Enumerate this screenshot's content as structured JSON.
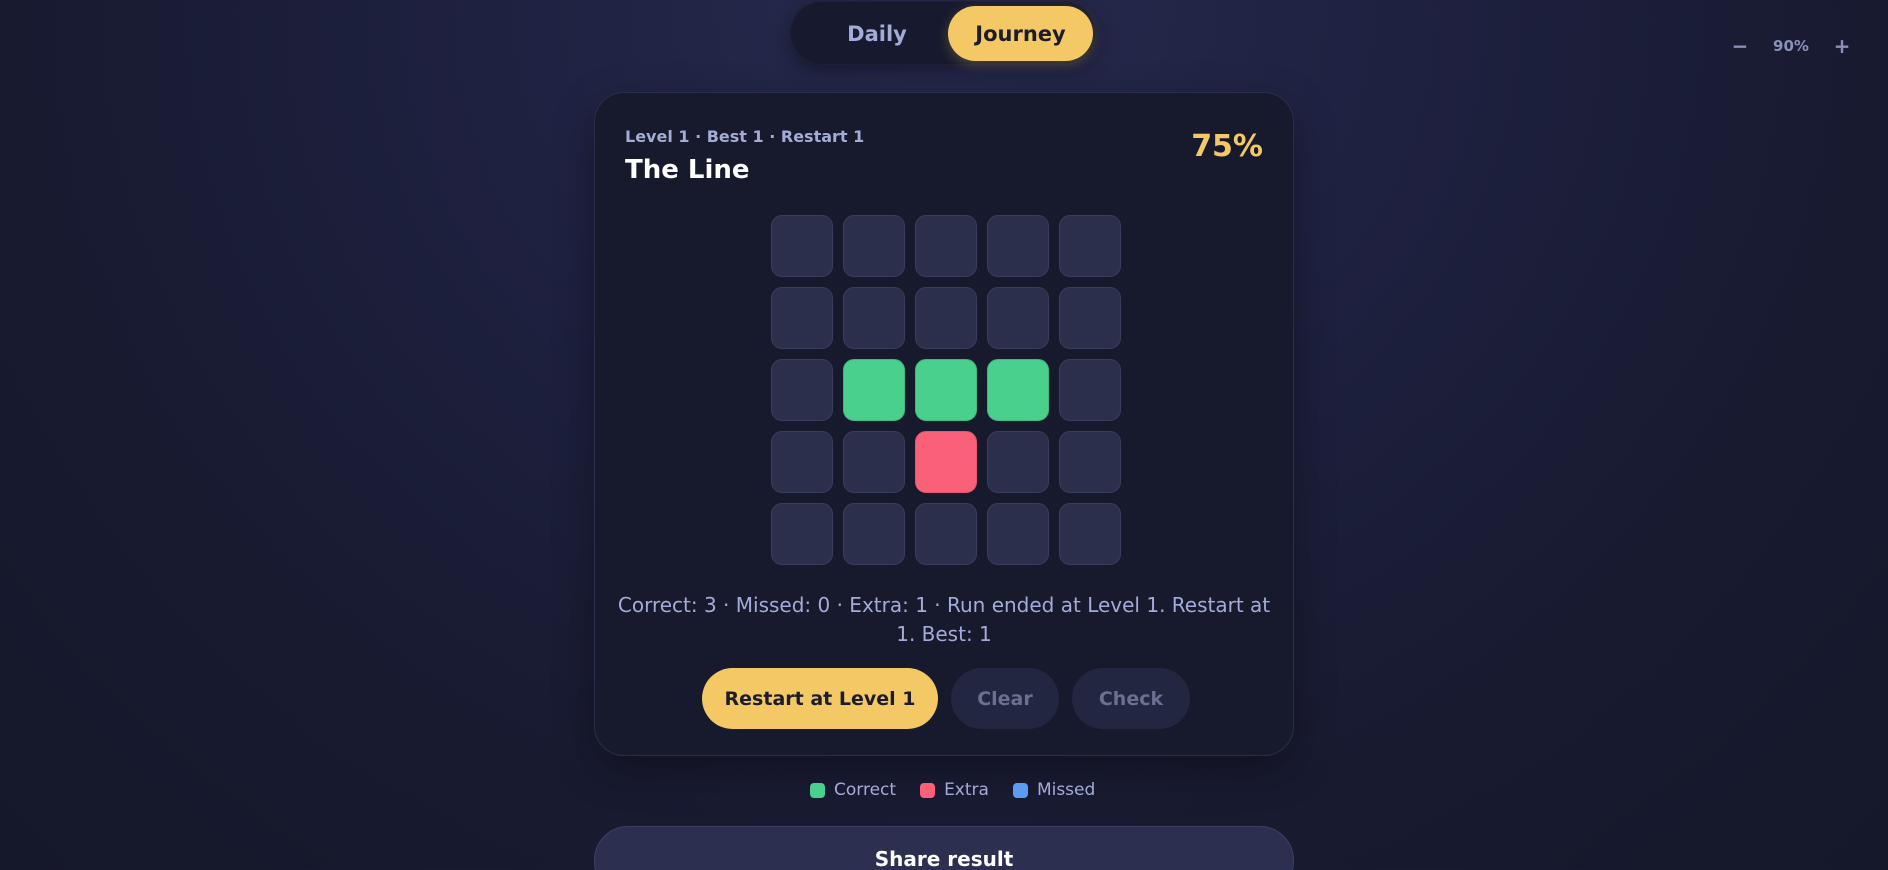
{
  "modes": {
    "daily_label": "Daily",
    "journey_label": "Journey",
    "active": "Journey"
  },
  "zoom": {
    "minus": "−",
    "value": "90%",
    "plus": "+"
  },
  "card": {
    "meta": "Level 1 · Best 1 · Restart 1",
    "title": "The Line",
    "percent": "75%"
  },
  "grid": {
    "rows": 5,
    "cols": 5,
    "cells": [
      [
        "empty",
        "empty",
        "empty",
        "empty",
        "empty"
      ],
      [
        "empty",
        "empty",
        "empty",
        "empty",
        "empty"
      ],
      [
        "empty",
        "correct",
        "correct",
        "correct",
        "empty"
      ],
      [
        "empty",
        "empty",
        "extra",
        "empty",
        "empty"
      ],
      [
        "empty",
        "empty",
        "empty",
        "empty",
        "empty"
      ]
    ]
  },
  "result": {
    "text": "Correct: 3 · Missed: 0 · Extra: 1 · Run ended at Level 1. Restart at 1. Best: 1"
  },
  "actions": {
    "restart_label": "Restart at Level 1",
    "clear_label": "Clear",
    "check_label": "Check"
  },
  "legend": {
    "correct_label": "Correct",
    "extra_label": "Extra",
    "missed_label": "Missed"
  },
  "colors": {
    "correct": "#48d08c",
    "extra": "#fb6079",
    "missed": "#5b9cf2",
    "accent": "#f4c865"
  },
  "share": {
    "label": "Share result"
  }
}
